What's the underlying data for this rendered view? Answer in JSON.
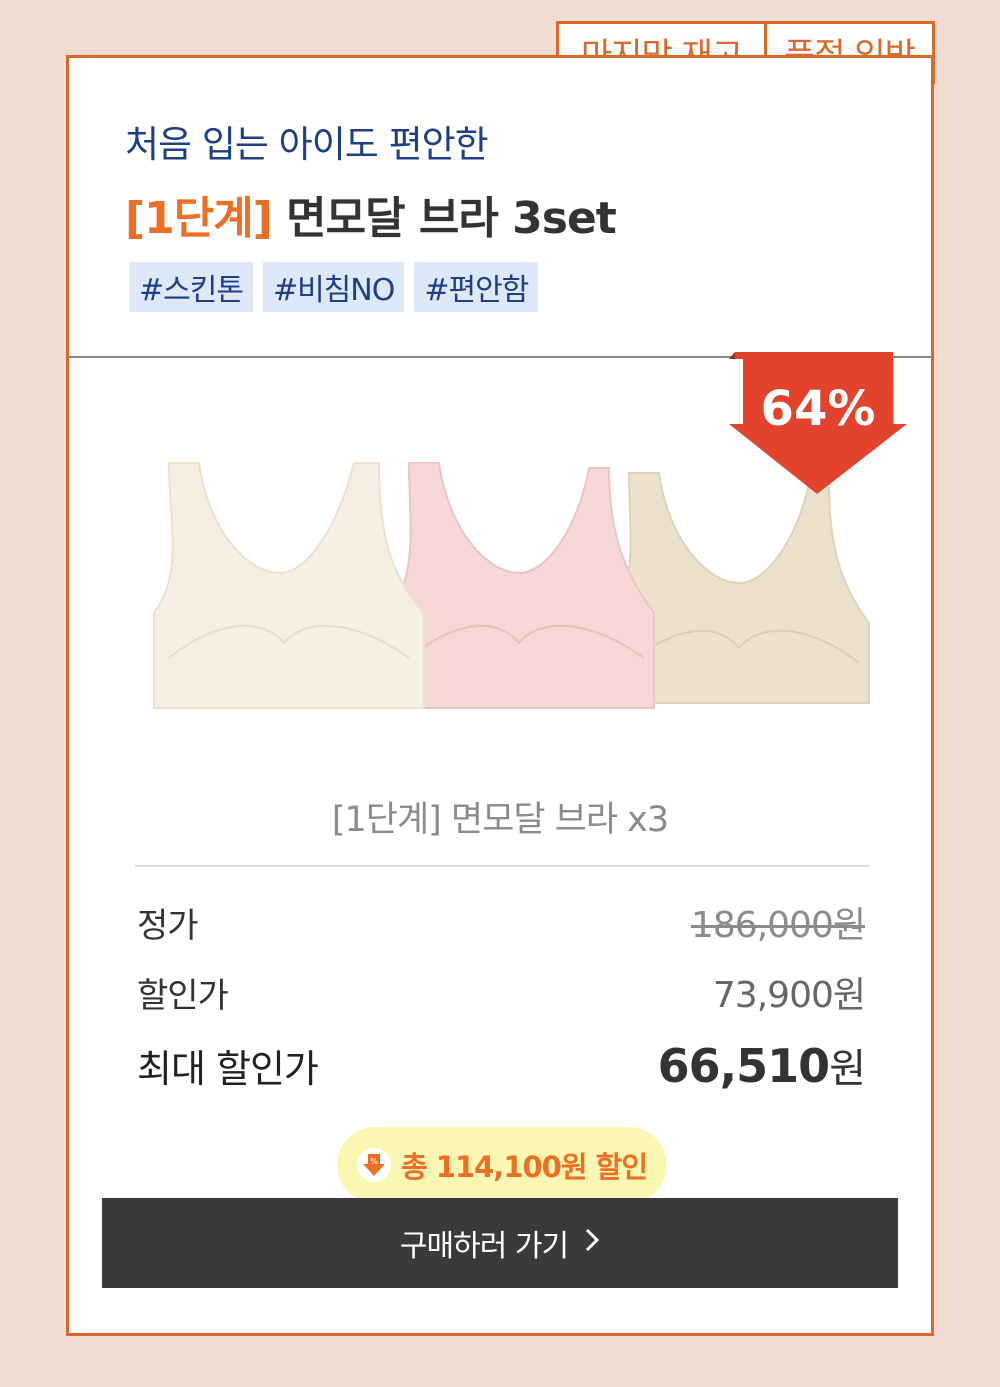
{
  "badges": {
    "last_stock": "마지막 재고",
    "sold_out_soon": "품절 임박"
  },
  "header": {
    "subtitle": "처음 입는 아이도 편안한",
    "title_step": "[1단계]",
    "title_main": "면모달 브라 3set"
  },
  "tags": [
    "#스킨톤",
    "#비침NO",
    "#편안함"
  ],
  "discount": {
    "percent_label": "64%"
  },
  "product": {
    "caption": "[1단계] 면모달 브라 x3",
    "colors": {
      "ivory": "#f7efe4",
      "pink": "#f5d8d6",
      "beige": "#ece1cd"
    }
  },
  "prices": {
    "regular_label": "정가",
    "regular_value": "186,000원",
    "sale_label": "할인가",
    "sale_value": "73,900원",
    "max_label": "최대 할인가",
    "max_number": "66,510",
    "max_unit": "원"
  },
  "savings": {
    "text": "총 114,100원 할인"
  },
  "buy_button": {
    "label": "구매하러 가기",
    "icon": "chevron-right-icon"
  },
  "colors": {
    "accent": "#d9692a",
    "orange": "#ee6f23",
    "navy": "#1c3f86",
    "ribbon": "#e2432a",
    "button": "#3a3a3a"
  }
}
